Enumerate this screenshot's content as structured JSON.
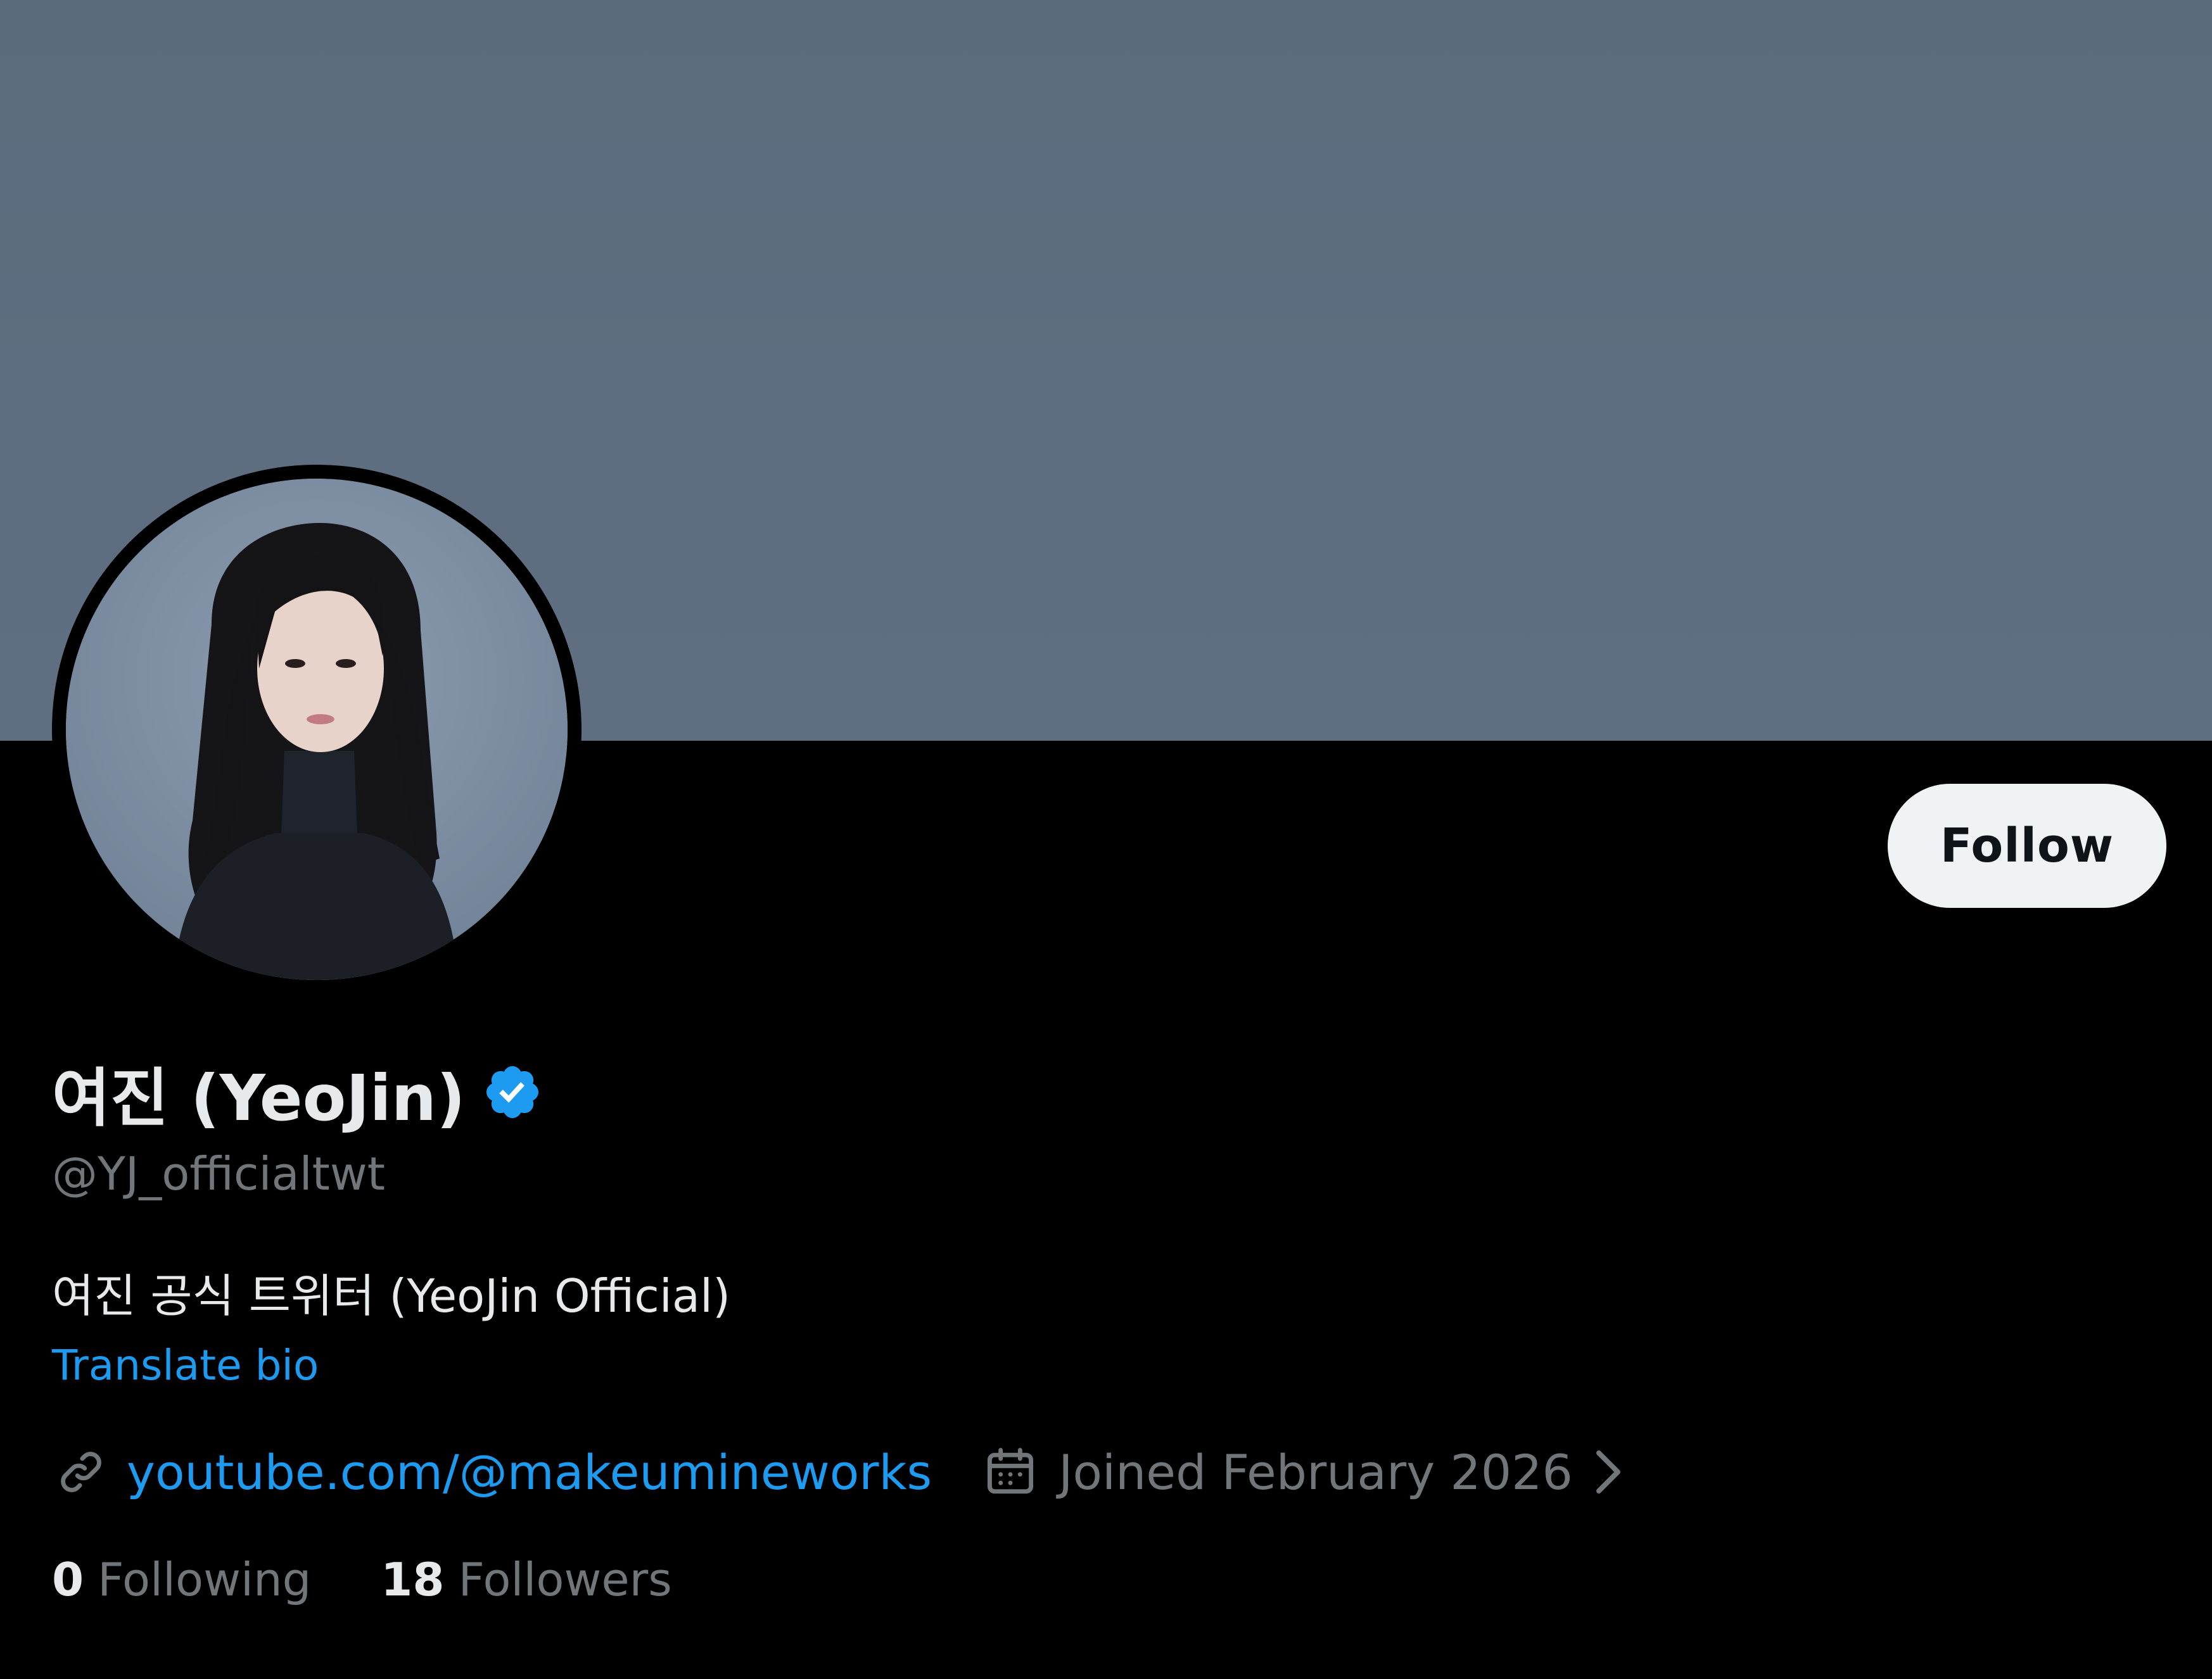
{
  "profile": {
    "display_name": "여진 (YeoJin)",
    "handle": "@YJ_officialtwt",
    "bio": "여진 공식 트위터 (YeoJin Official)",
    "translate_bio": "Translate bio",
    "link": "youtube.com/@makeumineworks",
    "joined": "Joined February 2026",
    "verified": true
  },
  "actions": {
    "follow_label": "Follow"
  },
  "stats": {
    "following_count": "0",
    "following_label": "Following",
    "followers_count": "18",
    "followers_label": "Followers"
  },
  "icons": {
    "verified": "verified-badge-icon",
    "link": "link-icon",
    "calendar": "calendar-icon",
    "chevron": "chevron-right-icon"
  },
  "colors": {
    "background": "#000000",
    "banner": "#5e6e80",
    "accent": "#1d9bf0",
    "primary_text": "#e7e9ea",
    "secondary_text": "#71767b",
    "follow_button_bg": "#eff3f4"
  }
}
